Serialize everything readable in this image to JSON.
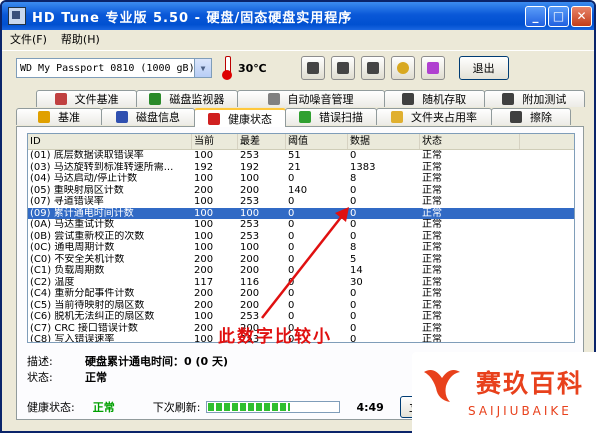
{
  "window": {
    "title": "HD Tune 专业版 5.50 - 硬盘/固态硬盘实用程序",
    "min_label": "_",
    "max_label": "□",
    "close_label": "✕"
  },
  "menu": {
    "file": "文件(F)",
    "help": "帮助(H)"
  },
  "toolbar": {
    "drive": "WD     My Passport 0810 (1000 gB)",
    "temperature": "30℃",
    "exit_label": "退出"
  },
  "tabs_top": [
    {
      "label": "文件基准",
      "icon": "benchmark-icon",
      "color": "#c04040"
    },
    {
      "label": "磁盘监视器",
      "icon": "monitor-icon",
      "color": "#2a8a2a"
    },
    {
      "label": "自动噪音管理",
      "icon": "speaker-icon",
      "color": "#808080"
    },
    {
      "label": "随机存取",
      "icon": "random-access-icon",
      "color": "#404040"
    },
    {
      "label": "附加测试",
      "icon": "extra-tests-icon",
      "color": "#404040"
    }
  ],
  "tabs_bottom": [
    {
      "label": "基准",
      "icon": "bulb-icon",
      "color": "#e0a000"
    },
    {
      "label": "磁盘信息",
      "icon": "info-icon",
      "color": "#3050b0"
    },
    {
      "label": "健康状态",
      "icon": "health-cross-icon",
      "color": "#d02020"
    },
    {
      "label": "错误扫描",
      "icon": "error-scan-icon",
      "color": "#30a030"
    },
    {
      "label": "文件夹占用率",
      "icon": "folder-icon",
      "color": "#e0b030"
    },
    {
      "label": "擦除",
      "icon": "erase-icon",
      "color": "#404040"
    }
  ],
  "grid": {
    "headers": [
      "ID",
      "当前",
      "最差",
      "阈值",
      "数据",
      "状态"
    ],
    "rows": [
      [
        "(01) 底层数据读取错误率",
        "100",
        "253",
        "51",
        "0",
        "正常"
      ],
      [
        "(03) 马达旋转到标准转速所需...",
        "192",
        "192",
        "21",
        "1383",
        "正常"
      ],
      [
        "(04) 马达启动/停止计数",
        "100",
        "100",
        "0",
        "8",
        "正常"
      ],
      [
        "(05) 重映射扇区计数",
        "200",
        "200",
        "140",
        "0",
        "正常"
      ],
      [
        "(07) 寻道错误率",
        "100",
        "253",
        "0",
        "0",
        "正常"
      ],
      [
        "(09) 累计通电时间计数",
        "100",
        "100",
        "0",
        "0",
        "正常"
      ],
      [
        "(0A) 马达重试计数",
        "100",
        "253",
        "0",
        "0",
        "正常"
      ],
      [
        "(0B) 尝试重新校正的次数",
        "100",
        "253",
        "0",
        "0",
        "正常"
      ],
      [
        "(0C) 通电周期计数",
        "100",
        "100",
        "0",
        "8",
        "正常"
      ],
      [
        "(C0) 不安全关机计数",
        "200",
        "200",
        "0",
        "5",
        "正常"
      ],
      [
        "(C1) 负载周期数",
        "200",
        "200",
        "0",
        "14",
        "正常"
      ],
      [
        "(C2) 温度",
        "117",
        "116",
        "0",
        "30",
        "正常"
      ],
      [
        "(C4) 重新分配事件计数",
        "200",
        "200",
        "0",
        "0",
        "正常"
      ],
      [
        "(C5) 当前待映射的扇区数",
        "200",
        "200",
        "0",
        "0",
        "正常"
      ],
      [
        "(C6) 脱机无法纠正的扇区数",
        "100",
        "253",
        "0",
        "0",
        "正常"
      ],
      [
        "(C7) CRC 接口错误计数",
        "200",
        "200",
        "0",
        "0",
        "正常"
      ],
      [
        "(C8) 写入错误速率",
        "100",
        "253",
        "0",
        "0",
        "正常"
      ]
    ],
    "selected_index": 5
  },
  "details": {
    "desc_label": "描述:",
    "desc_value": "硬盘累计通电时间：0 (0 天)",
    "status_label": "状态:",
    "status_value": "正常"
  },
  "footer": {
    "health_label": "健康状态:",
    "health_value": "正常",
    "next_refresh_label": "下次刷新:",
    "progress": 0.62,
    "time": "4:49",
    "refresh_button": "立即刷新"
  },
  "annotation": {
    "text": "此数字比较小",
    "color": "#e01010"
  },
  "watermark": {
    "title": "赛玖百科",
    "subtitle": "SAIJIUBAIKE",
    "color": "#e8411c"
  }
}
